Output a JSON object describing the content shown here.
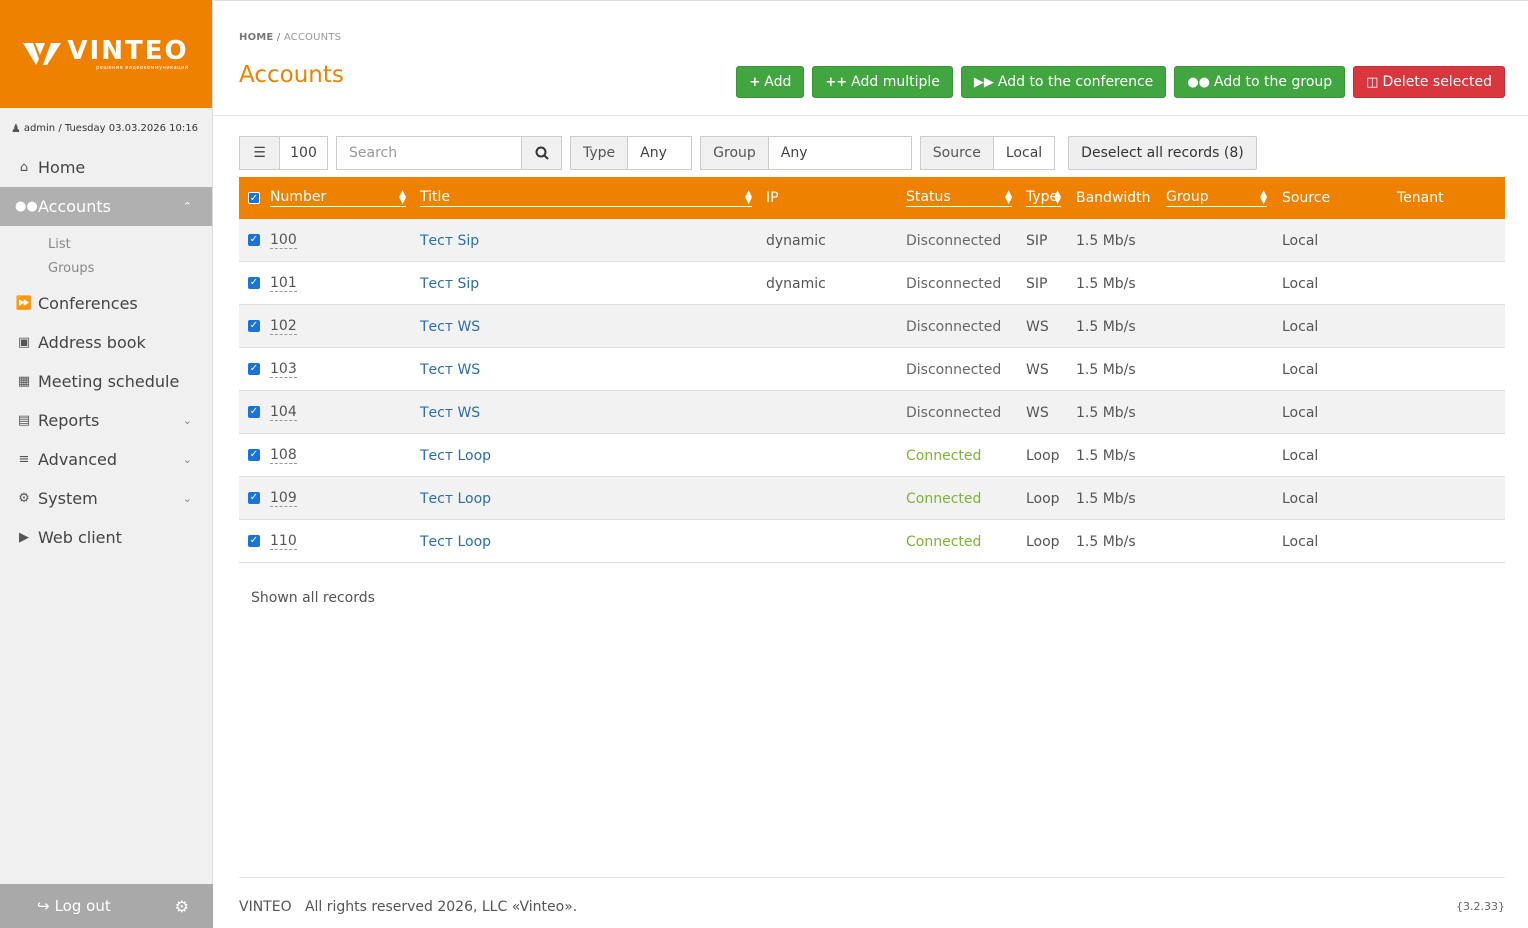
{
  "brand": {
    "name": "VINTEO",
    "tagline": "решения видеокоммуникаций",
    "accent": "#ee8200"
  },
  "user": {
    "line": "admin / Tuesday 03.03.2026 10:16"
  },
  "sidebar": {
    "items": [
      {
        "label": "Home",
        "icon": "home-icon"
      },
      {
        "label": "Accounts",
        "icon": "users-icon",
        "active": true
      },
      {
        "label": "Conferences",
        "icon": "forward-icon"
      },
      {
        "label": "Address book",
        "icon": "address-book-icon"
      },
      {
        "label": "Meeting schedule",
        "icon": "calendar-icon"
      },
      {
        "label": "Reports",
        "icon": "book-icon"
      },
      {
        "label": "Advanced",
        "icon": "sliders-icon"
      },
      {
        "label": "System",
        "icon": "gears-icon"
      },
      {
        "label": "Web client",
        "icon": "video-camera-icon"
      }
    ],
    "subitems": [
      "List",
      "Groups"
    ],
    "logout": "Log out"
  },
  "breadcrumb": {
    "home": "HOME",
    "sep": "/",
    "current": "ACCOUNTS"
  },
  "page": {
    "title": "Accounts"
  },
  "actions": {
    "add": "Add",
    "add_multiple": "Add multiple",
    "add_conference": "Add to the conference",
    "add_group": "Add to the group",
    "delete_selected": "Delete selected"
  },
  "filters": {
    "page_size": "100",
    "search_placeholder": "Search",
    "type_label": "Type",
    "type_value": "Any",
    "group_label": "Group",
    "group_value": "Any",
    "source_label": "Source",
    "source_value": "Local",
    "deselect": "Deselect all records (8)"
  },
  "table": {
    "columns": {
      "number": "Number",
      "title": "Title",
      "ip": "IP",
      "status": "Status",
      "type": "Type",
      "bandwidth": "Bandwidth",
      "group": "Group",
      "source": "Source",
      "tenant": "Tenant"
    },
    "rows": [
      {
        "number": "100",
        "title": "Тест Sip",
        "ip": "dynamic",
        "status": "Disconnected",
        "type": "SIP",
        "bandwidth": "1.5 Mb/s",
        "group": "",
        "source": "Local",
        "tenant": ""
      },
      {
        "number": "101",
        "title": "Тест Sip",
        "ip": "dynamic",
        "status": "Disconnected",
        "type": "SIP",
        "bandwidth": "1.5 Mb/s",
        "group": "",
        "source": "Local",
        "tenant": ""
      },
      {
        "number": "102",
        "title": "Тест WS",
        "ip": "",
        "status": "Disconnected",
        "type": "WS",
        "bandwidth": "1.5 Mb/s",
        "group": "",
        "source": "Local",
        "tenant": ""
      },
      {
        "number": "103",
        "title": "Тест WS",
        "ip": "",
        "status": "Disconnected",
        "type": "WS",
        "bandwidth": "1.5 Mb/s",
        "group": "",
        "source": "Local",
        "tenant": ""
      },
      {
        "number": "104",
        "title": "Тест WS",
        "ip": "",
        "status": "Disconnected",
        "type": "WS",
        "bandwidth": "1.5 Mb/s",
        "group": "",
        "source": "Local",
        "tenant": ""
      },
      {
        "number": "108",
        "title": "Тест Loop",
        "ip": "",
        "status": "Connected",
        "type": "Loop",
        "bandwidth": "1.5 Mb/s",
        "group": "",
        "source": "Local",
        "tenant": ""
      },
      {
        "number": "109",
        "title": "Тест Loop",
        "ip": "",
        "status": "Connected",
        "type": "Loop",
        "bandwidth": "1.5 Mb/s",
        "group": "",
        "source": "Local",
        "tenant": ""
      },
      {
        "number": "110",
        "title": "Тест Loop",
        "ip": "",
        "status": "Connected",
        "type": "Loop",
        "bandwidth": "1.5 Mb/s",
        "group": "",
        "source": "Local",
        "tenant": ""
      }
    ],
    "shown": "Shown all records"
  },
  "footer": {
    "text": "VINTEO   All rights reserved 2026, LLC «Vinteo».",
    "version": "{3.2.33}"
  }
}
